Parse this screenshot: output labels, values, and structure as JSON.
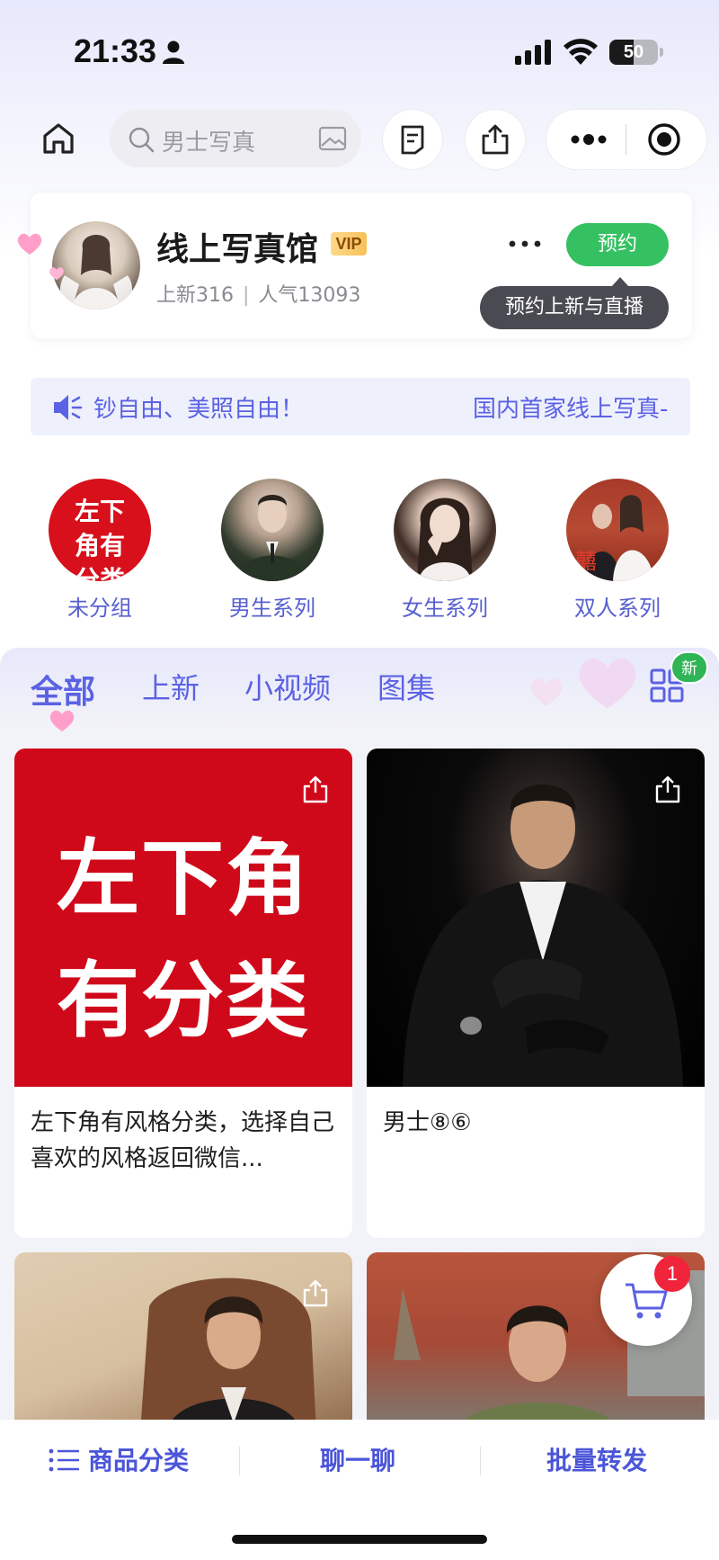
{
  "status_bar": {
    "time": "21:33",
    "battery_percent": 50,
    "battery_label": "50",
    "icons": [
      "person-icon",
      "signal-icon",
      "wifi-icon",
      "battery-icon"
    ]
  },
  "nav": {
    "search_placeholder": "男士写真",
    "icons": [
      "home-icon",
      "search-icon",
      "image-search-icon",
      "document-icon",
      "share-icon",
      "more-dots-icon",
      "close-target-icon"
    ]
  },
  "shop": {
    "name": "线上写真馆",
    "vip": "VIP",
    "new_label": "上新316",
    "divider": "|",
    "popularity_label": "人气13093",
    "reserve_label": "预约",
    "tooltip": "预约上新与直播"
  },
  "notice": {
    "text_part1": "钞自由、美照自由！",
    "text_part2": "国内首家线上写真-"
  },
  "categories": [
    {
      "label": "未分组",
      "cover_text": "左下角有分类"
    },
    {
      "label": "男生系列"
    },
    {
      "label": "女生系列"
    },
    {
      "label": "双人系列"
    }
  ],
  "tabs": [
    {
      "label": "全部",
      "active": true
    },
    {
      "label": "上新",
      "active": false
    },
    {
      "label": "小视频",
      "active": false
    },
    {
      "label": "图集",
      "active": false
    }
  ],
  "grid_badge": "新",
  "products": [
    {
      "cover_line1": "左下角",
      "cover_line2": "有分类",
      "title": "左下角有风格分类，选择自己喜欢的风格返回微信..."
    },
    {
      "title": "男士⑧⑥"
    },
    {
      "title": ""
    },
    {
      "title": ""
    }
  ],
  "cart": {
    "count": "1"
  },
  "bottom_bar": {
    "category_label": "商品分类",
    "chat_label": "聊一聊",
    "forward_label": "批量转发"
  },
  "colors": {
    "accent": "#5b62e3",
    "reserve_green": "#35c162",
    "badge_red": "#f0243a",
    "cover_red": "#d0091a"
  }
}
